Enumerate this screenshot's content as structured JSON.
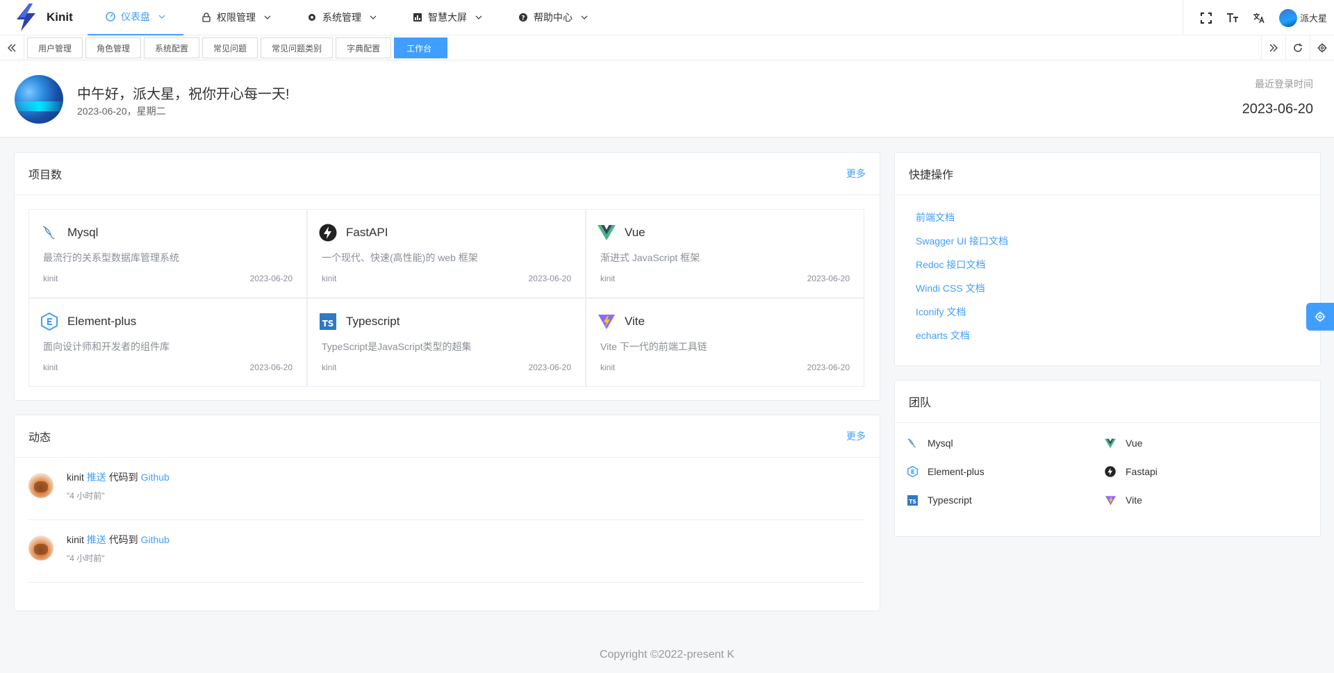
{
  "app": {
    "name": "Kinit"
  },
  "colors": {
    "accent": "#409eff",
    "text": "#303133",
    "muted": "#8a8f99"
  },
  "menu": [
    {
      "label": "仪表盘",
      "icon": "dashboard-icon",
      "active": true
    },
    {
      "label": "权限管理",
      "icon": "lock-icon"
    },
    {
      "label": "系统管理",
      "icon": "gear-icon"
    },
    {
      "label": "智慧大屏",
      "icon": "chart-icon"
    },
    {
      "label": "帮助中心",
      "icon": "help-icon"
    }
  ],
  "user": {
    "name": "派大星"
  },
  "tags": [
    {
      "label": "用户管理"
    },
    {
      "label": "角色管理"
    },
    {
      "label": "系统配置"
    },
    {
      "label": "常见问题"
    },
    {
      "label": "常见问题类别"
    },
    {
      "label": "字典配置"
    },
    {
      "label": "工作台",
      "active": true
    }
  ],
  "greeting": {
    "title": "中午好，派大星，祝你开心每一天!",
    "date": "2023-06-20，星期二",
    "last_login_label": "最近登录时间",
    "last_login_value": "2023-06-20"
  },
  "projects": {
    "title": "项目数",
    "more": "更多",
    "items": [
      {
        "name": "Mysql",
        "desc": "最流行的关系型数据库管理系统",
        "owner": "kinit",
        "date": "2023-06-20",
        "icon": "mysql-icon"
      },
      {
        "name": "FastAPI",
        "desc": "一个现代、快速(高性能)的 web 框架",
        "owner": "kinit",
        "date": "2023-06-20",
        "icon": "fastapi-icon"
      },
      {
        "name": "Vue",
        "desc": "渐进式 JavaScript 框架",
        "owner": "kinit",
        "date": "2023-06-20",
        "icon": "vue-icon"
      },
      {
        "name": "Element-plus",
        "desc": "面向设计师和开发者的组件库",
        "owner": "kinit",
        "date": "2023-06-20",
        "icon": "element-plus-icon"
      },
      {
        "name": "Typescript",
        "desc": "TypeScript是JavaScript类型的超集",
        "owner": "kinit",
        "date": "2023-06-20",
        "icon": "typescript-icon"
      },
      {
        "name": "Vite",
        "desc": "Vite 下一代的前端工具链",
        "owner": "kinit",
        "date": "2023-06-20",
        "icon": "vite-icon"
      }
    ]
  },
  "dynamics": {
    "title": "动态",
    "more": "更多",
    "items": [
      {
        "user": "kinit",
        "action": "推送",
        "mid": "代码到",
        "target": "Github",
        "time": "\"4 小时前\""
      },
      {
        "user": "kinit",
        "action": "推送",
        "mid": "代码到",
        "target": "Github",
        "time": "\"4 小时前\""
      }
    ]
  },
  "quick": {
    "title": "快捷操作",
    "links": [
      "前端文档",
      "Swagger UI 接口文档",
      "Redoc 接口文档",
      "Windi CSS 文档",
      "Iconify 文档",
      "echarts 文档"
    ]
  },
  "team": {
    "title": "团队",
    "items": [
      {
        "name": "Mysql",
        "icon": "mysql-icon"
      },
      {
        "name": "Vue",
        "icon": "vue-icon"
      },
      {
        "name": "Element-plus",
        "icon": "element-plus-icon"
      },
      {
        "name": "Fastapi",
        "icon": "fastapi-icon"
      },
      {
        "name": "Typescript",
        "icon": "typescript-icon"
      },
      {
        "name": "Vite",
        "icon": "vite-icon"
      }
    ]
  },
  "footer": {
    "text": "Copyright ©2022-present K"
  }
}
